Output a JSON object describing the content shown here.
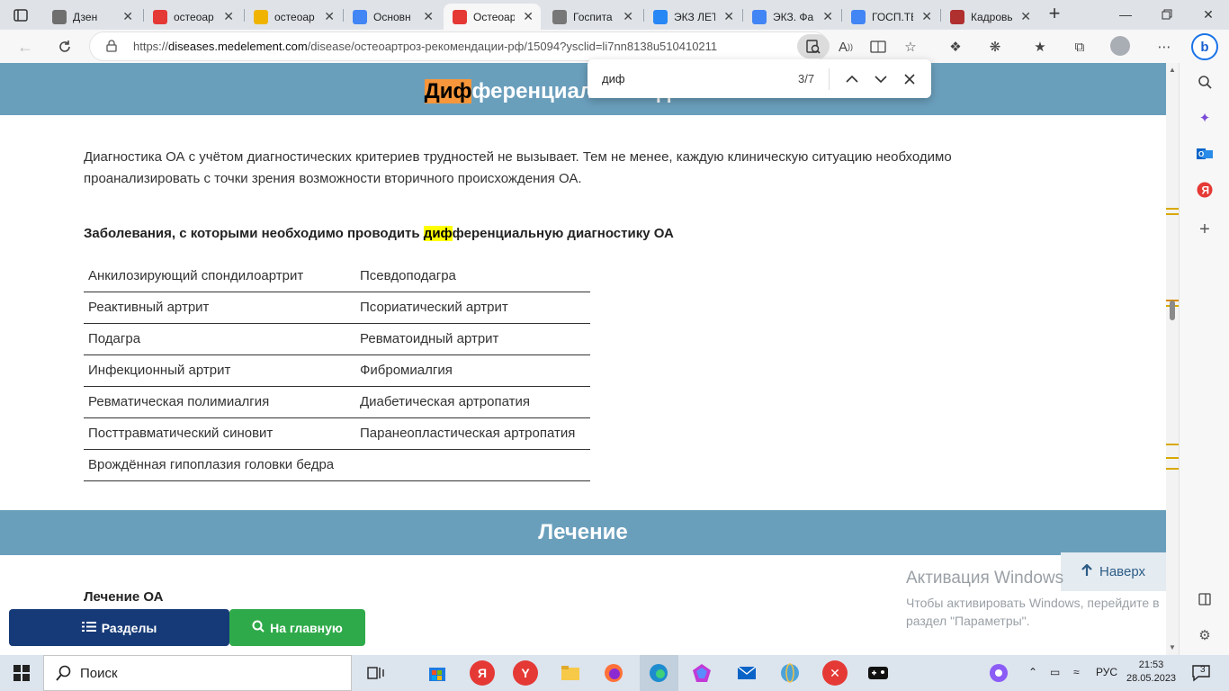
{
  "browser": {
    "tabs": [
      {
        "title": "Дзен",
        "favicon": "dzen-icon",
        "color": "#6f6f6f"
      },
      {
        "title": "остеоар",
        "favicon": "yandex-icon",
        "color": "#e53935"
      },
      {
        "title": "остеоар",
        "favicon": "yandex-images-icon",
        "color": "#f0b400"
      },
      {
        "title": "Основн",
        "favicon": "google-icon",
        "color": "#4285f4"
      },
      {
        "title": "Остеоар",
        "favicon": "medelement-icon",
        "color": "#e53935"
      },
      {
        "title": "Госпита",
        "favicon": "doc-icon",
        "color": "#777777"
      },
      {
        "title": "ЭКЗ ЛЕТ",
        "favicon": "vk-icon",
        "color": "#2787f5"
      },
      {
        "title": "ЭКЗ. Фа",
        "favicon": "docs-icon",
        "color": "#4285f4"
      },
      {
        "title": "ГОСП.ТЕ",
        "favicon": "docs-icon",
        "color": "#4285f4"
      },
      {
        "title": "Кадровь",
        "favicon": "app-icon",
        "color": "#b03030"
      }
    ],
    "active_tab_index": 4,
    "url_prefix": "https://",
    "url_host": "diseases.medelement.com",
    "url_path": "/disease/остеоартроз-рекомендации-рф/15094?ysclid=li7nn8138u510410211"
  },
  "find": {
    "query": "диф",
    "count": "3/7"
  },
  "page": {
    "section1_title_hl": "Диф",
    "section1_title_rest": "ференциальный диагноз",
    "intro": "Диагностика ОА с учётом диагностических критериев трудностей не вызывает. Тем не менее, каждую клиническую ситуацию необходимо проанализировать с точки зрения возможности вторичного происхождения ОА.",
    "subhead_pre": "Заболевания, с которыми необходимо проводить ",
    "subhead_hl": "диф",
    "subhead_post": "ференциальную диагностику ОА",
    "table": [
      [
        "Анкилозирующий спондилоартрит",
        "Псевдоподагра"
      ],
      [
        "Реактивный артрит",
        "Псориатический артрит"
      ],
      [
        "Подагра",
        "Ревматоидный артрит"
      ],
      [
        "Инфекционный артрит",
        "Фибромиалгия"
      ],
      [
        "Ревматическая полимиалгия",
        "Диабетическая артропатия"
      ],
      [
        "Посттравматический синовит",
        "Паранеопластическая артропатия"
      ],
      [
        "Врождённая гипоплазия головки бедра",
        ""
      ]
    ],
    "section2_title": "Лечение",
    "treatment_head": "Лечение ОА",
    "btn_sections": "Разделы",
    "btn_home": "На главную",
    "btn_up": "Наверх"
  },
  "activation": {
    "line1": "Активация Windows",
    "line2": "Чтобы активировать Windows, перейдите в",
    "line3": "раздел \"Параметры\"."
  },
  "taskbar": {
    "search_placeholder": "Поиск",
    "lang": "РУС",
    "time": "21:53",
    "date": "28.05.2023",
    "notifications": "3"
  },
  "colors": {
    "band": "#6a9fbc",
    "highlight": "#ffff00",
    "current_highlight": "#f7963a",
    "sections_button": "#163a77",
    "home_button": "#2faa4a"
  }
}
